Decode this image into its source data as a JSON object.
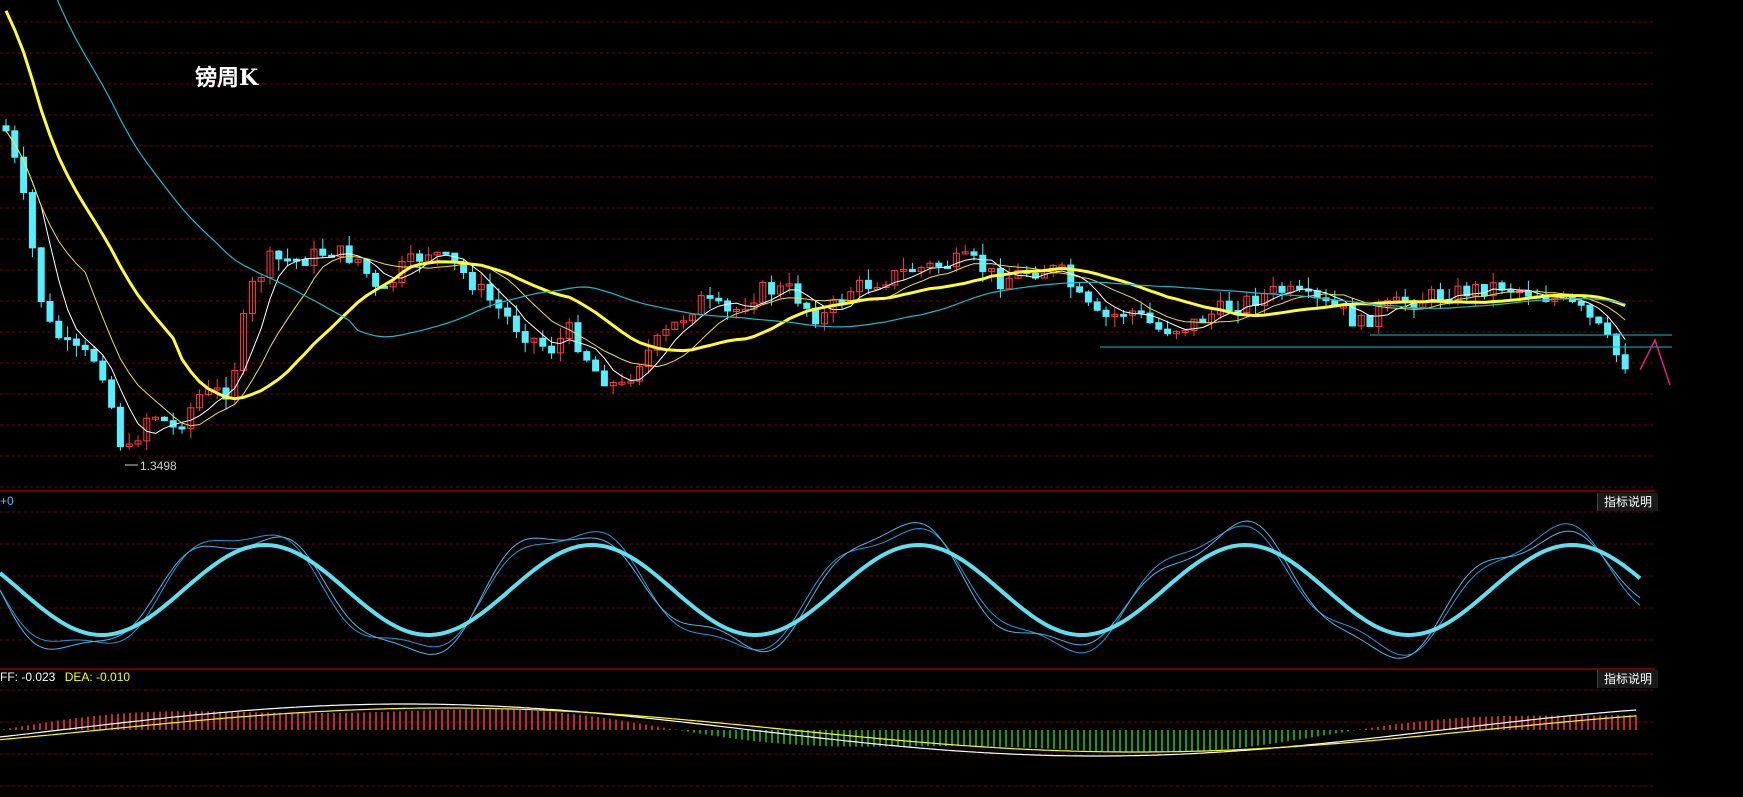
{
  "title": "镑周K",
  "price_panel": {
    "low_label": "1.3498"
  },
  "kdj_panel": {
    "label": "+0",
    "button": "指标说明"
  },
  "macd_panel": {
    "diff_prefix": "FF: ",
    "diff_value": "-0.023",
    "dea_prefix": "DEA: ",
    "dea_value": "-0.010",
    "button": "指标说明"
  },
  "colors": {
    "up": "#ff3b3b",
    "down": "#54f0ff",
    "ma_yellow": "#ffff33",
    "ma_cyan": "#1fb8c8",
    "grid": "#7a0000",
    "diff": "#ffffff",
    "dea": "#ffff00",
    "macd_up": "#ff3b3b",
    "macd_down": "#19d219"
  },
  "chart_data": {
    "type": "candlestick",
    "panels": [
      "price",
      "kdj",
      "macd"
    ],
    "low_annotation": 1.3498,
    "candle_count": 185
  }
}
